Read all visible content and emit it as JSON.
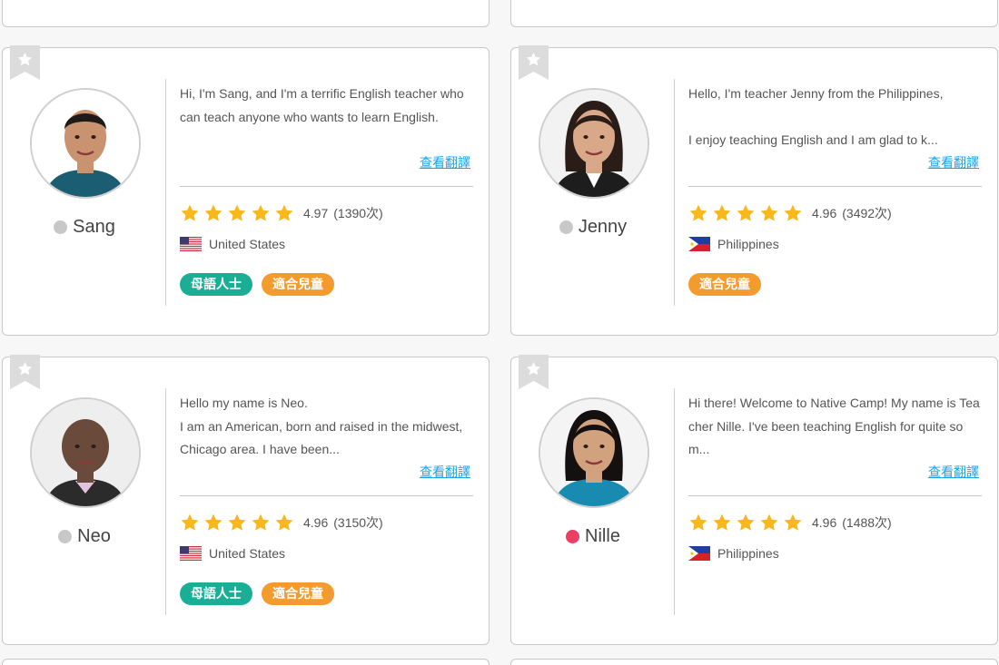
{
  "translate_label": "查看翻譯",
  "colors": {
    "teal": "#1aaf94",
    "orange": "#f39b2d",
    "star": "#f8b81c",
    "offline": "#c8c8c8",
    "online": "#ee3d62",
    "link": "#1aa3e8"
  },
  "teachers": [
    {
      "name": "Sang",
      "status": "offline",
      "bio": "Hi, I'm Sang, and I'm a terrific English teacher who can teach anyone who wants to learn English.",
      "rating": "4.97",
      "reviews": "(1390次)",
      "country": "United States",
      "flag": "us-flag-icon",
      "tags": [
        "母語人士",
        "適合兒童"
      ]
    },
    {
      "name": "Jenny",
      "status": "offline",
      "bio": "Hello, I'm teacher Jenny from the Philippines,\n\nI enjoy teaching English and I am glad to k...",
      "rating": "4.96",
      "reviews": "(3492次)",
      "country": "Philippines",
      "flag": "ph-flag-icon",
      "tags": [
        "適合兒童"
      ]
    },
    {
      "name": "Neo",
      "status": "offline",
      "bio": "Hello my name is Neo.\nI am an American, born and raised in the midwest, Chicago area. I have been...",
      "rating": "4.96",
      "reviews": "(3150次)",
      "country": "United States",
      "flag": "us-flag-icon",
      "tags": [
        "母語人士",
        "適合兒童"
      ]
    },
    {
      "name": "Nille",
      "status": "online",
      "bio": "Hi there! Welcome to Native Camp! My name is Teacher Nille. I've been teaching English for quite som...",
      "rating": "4.96",
      "reviews": "(1488次)",
      "country": "Philippines",
      "flag": "ph-flag-icon",
      "tags": []
    }
  ]
}
